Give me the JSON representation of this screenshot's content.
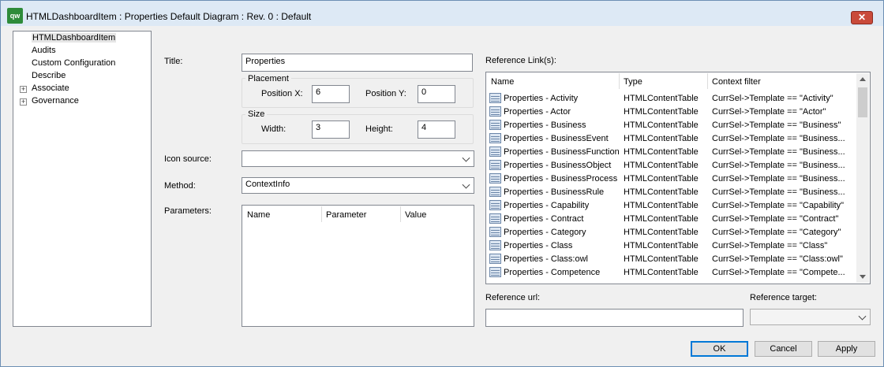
{
  "window": {
    "app_icon": "qw",
    "title": "HTMLDashboardItem : Properties Default Diagram : Rev. 0  : Default",
    "close_icon": "close-icon",
    "close_glyph": "✕"
  },
  "tree": {
    "items": [
      {
        "label": "HTMLDashboardItem",
        "selected": true
      },
      {
        "label": "Audits"
      },
      {
        "label": "Custom Configuration"
      },
      {
        "label": "Describe"
      },
      {
        "label": "Associate",
        "expandable": true
      },
      {
        "label": "Governance",
        "expandable": true
      }
    ],
    "expand_glyph": "+"
  },
  "form": {
    "title_label": "Title:",
    "title_value": "Properties",
    "placement_label": "Placement",
    "position_x_label": "Position X:",
    "position_x_value": "6",
    "position_y_label": "Position Y:",
    "position_y_value": "0",
    "size_label": "Size",
    "width_label": "Width:",
    "width_value": "3",
    "height_label": "Height:",
    "height_value": "4",
    "icon_source_label": "Icon source:",
    "icon_source_value": "",
    "method_label": "Method:",
    "method_value": "ContextInfo",
    "parameters_label": "Parameters:",
    "parameters_columns": [
      "Name",
      "Parameter",
      "Value"
    ]
  },
  "reference_links": {
    "label": "Reference Link(s):",
    "columns": [
      "Name",
      "Type",
      "Context filter"
    ],
    "rows": [
      {
        "name": "Properties - Activity",
        "type": "HTMLContentTable",
        "filter": "CurrSel->Template == \"Activity\""
      },
      {
        "name": "Properties - Actor",
        "type": "HTMLContentTable",
        "filter": "CurrSel->Template == \"Actor\""
      },
      {
        "name": "Properties - Business",
        "type": "HTMLContentTable",
        "filter": "CurrSel->Template == \"Business\""
      },
      {
        "name": "Properties - BusinessEvent",
        "type": "HTMLContentTable",
        "filter": "CurrSel->Template == \"Business..."
      },
      {
        "name": "Properties - BusinessFunction",
        "type": "HTMLContentTable",
        "filter": "CurrSel->Template == \"Business..."
      },
      {
        "name": "Properties - BusinessObject",
        "type": "HTMLContentTable",
        "filter": "CurrSel->Template == \"Business..."
      },
      {
        "name": "Properties - BusinessProcess",
        "type": "HTMLContentTable",
        "filter": "CurrSel->Template == \"Business..."
      },
      {
        "name": "Properties - BusinessRule",
        "type": "HTMLContentTable",
        "filter": "CurrSel->Template == \"Business..."
      },
      {
        "name": "Properties - Capability",
        "type": "HTMLContentTable",
        "filter": "CurrSel->Template == \"Capability\""
      },
      {
        "name": "Properties - Contract",
        "type": "HTMLContentTable",
        "filter": "CurrSel->Template == \"Contract\""
      },
      {
        "name": "Properties - Category",
        "type": "HTMLContentTable",
        "filter": "CurrSel->Template == \"Category\""
      },
      {
        "name": "Properties - Class",
        "type": "HTMLContentTable",
        "filter": "CurrSel->Template == \"Class\""
      },
      {
        "name": "Properties - Class:owl",
        "type": "HTMLContentTable",
        "filter": "CurrSel->Template == \"Class:owl\""
      },
      {
        "name": "Properties - Competence",
        "type": "HTMLContentTable",
        "filter": "CurrSel->Template == \"Compete..."
      }
    ],
    "reference_url_label": "Reference url:",
    "reference_url_value": "",
    "reference_target_label": "Reference target:",
    "reference_target_value": ""
  },
  "buttons": {
    "ok": "OK",
    "cancel": "Cancel",
    "apply": "Apply"
  }
}
